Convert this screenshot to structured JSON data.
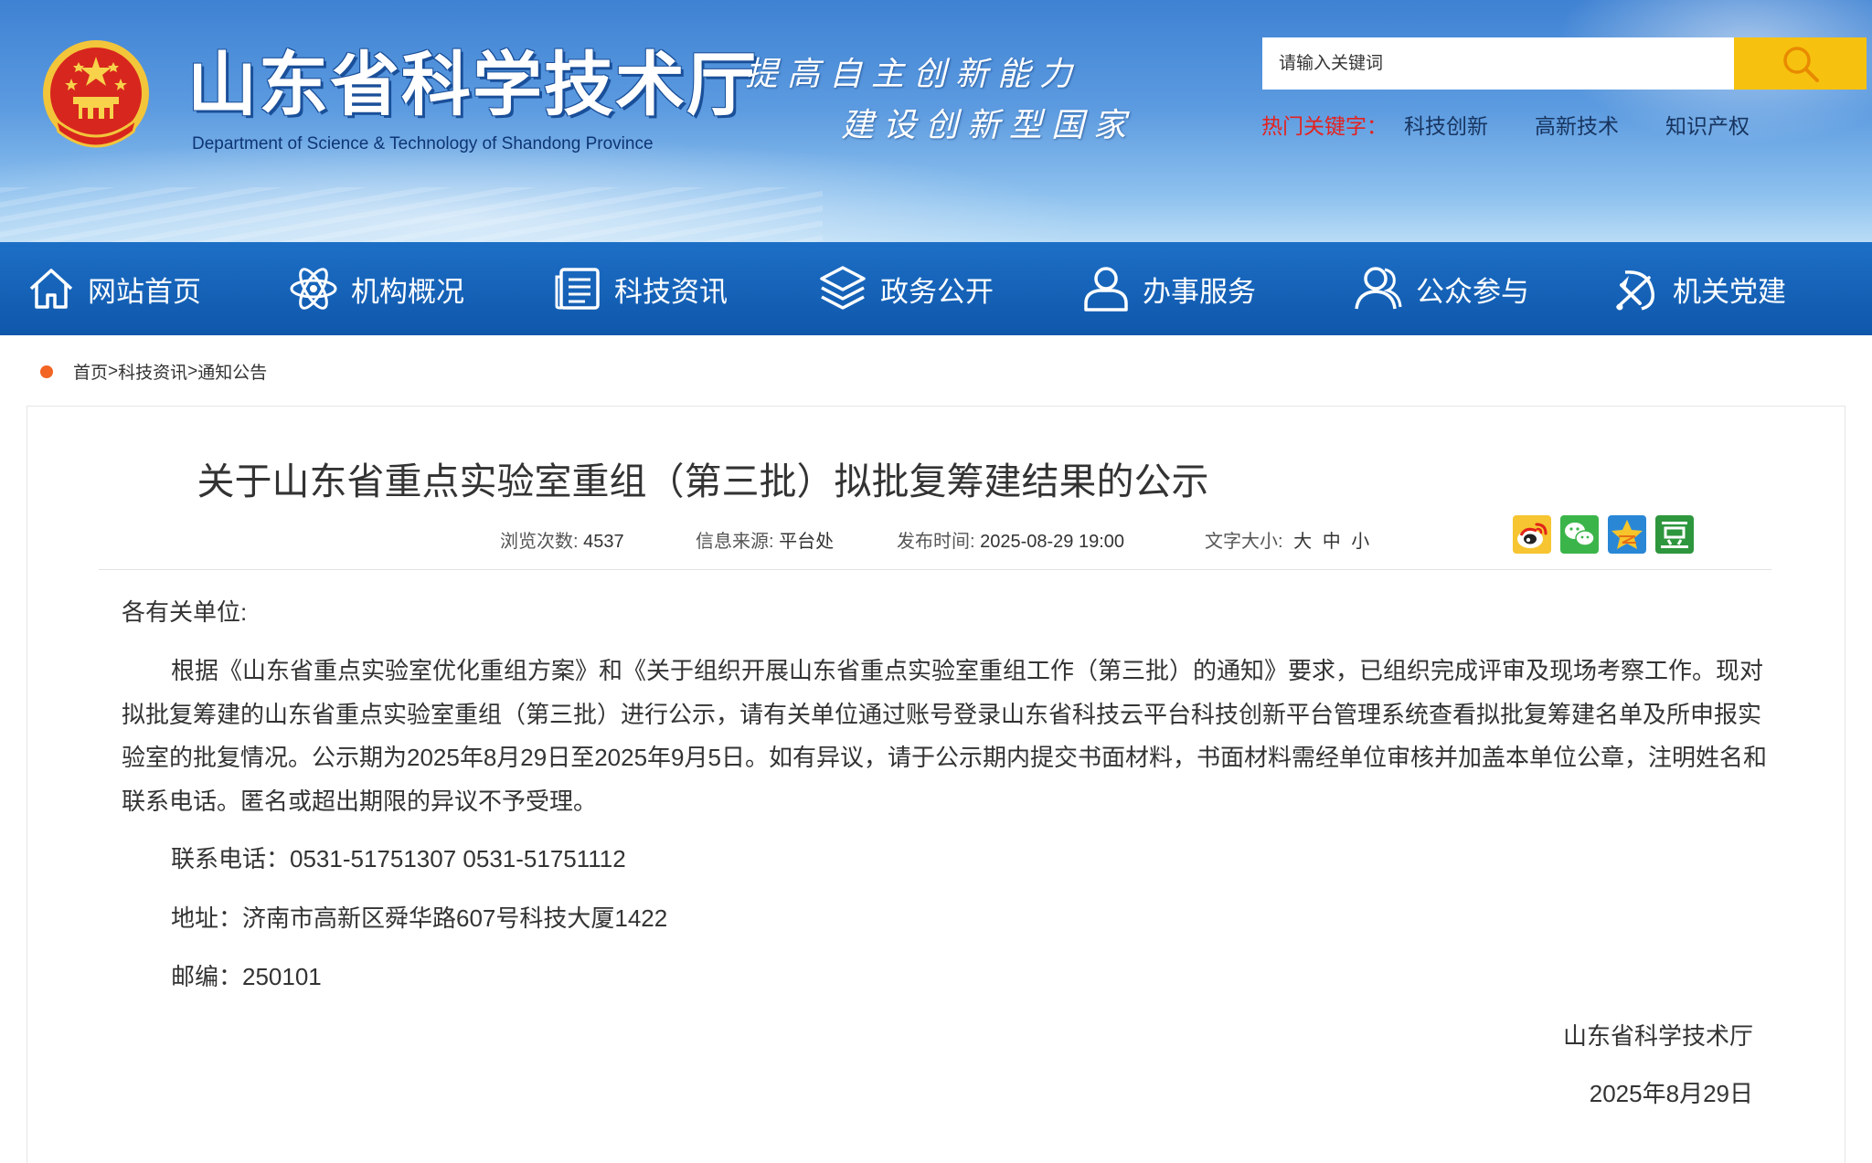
{
  "header": {
    "site_title": "山东省科学技术厅",
    "site_subtitle": "Department of Science & Technology of Shandong Province",
    "slogan_line1": "提高自主创新能力",
    "slogan_line2": "建设创新型国家",
    "search": {
      "placeholder": "请输入关键词",
      "value": ""
    },
    "hot_keywords": {
      "label": "热门关键字：",
      "items": [
        "科技创新",
        "高新技术",
        "知识产权"
      ]
    }
  },
  "nav": {
    "items": [
      {
        "label": "网站首页",
        "icon": "home-icon"
      },
      {
        "label": "机构概况",
        "icon": "atom-icon"
      },
      {
        "label": "科技资讯",
        "icon": "news-icon"
      },
      {
        "label": "政务公开",
        "icon": "layers-icon"
      },
      {
        "label": "办事服务",
        "icon": "user-icon"
      },
      {
        "label": "公众参与",
        "icon": "users-icon"
      },
      {
        "label": "机关党建",
        "icon": "party-emblem-icon"
      }
    ]
  },
  "breadcrumb": {
    "items": [
      "首页",
      "科技资讯",
      "通知公告"
    ],
    "separator": ">"
  },
  "article": {
    "title": "关于山东省重点实验室重组（第三批）拟批复筹建结果的公示",
    "meta": {
      "views_label": "浏览次数:",
      "views": "4537",
      "source_label": "信息来源:",
      "source": "平台处",
      "date_label": "发布时间:",
      "date": "2025-08-29 19:00",
      "font_size_label": "文字大小:",
      "font_sizes": [
        "大",
        "中",
        "小"
      ]
    },
    "share_icons": [
      "weibo-icon",
      "wechat-icon",
      "qzone-icon",
      "douban-icon"
    ],
    "salutation": "各有关单位:",
    "paragraph": "根据《山东省重点实验室优化重组方案》和《关于组织开展山东省重点实验室重组工作（第三批）的通知》要求，已组织完成评审及现场考察工作。现对拟批复筹建的山东省重点实验室重组（第三批）进行公示，请有关单位通过账号登录山东省科技云平台科技创新平台管理系统查看拟批复筹建名单及所申报实验室的批复情况。公示期为2025年8月29日至2025年9月5日。如有异议，请于公示期内提交书面材料，书面材料需经单位审核并加盖本单位公章，注明姓名和联系电话。匿名或超出期限的异议不予受理。",
    "contact_phone": "联系电话：0531-51751307 0531-51751112",
    "address": "地址：济南市高新区舜华路607号科技大厦1422",
    "postcode": "邮编：250101",
    "signature": "山东省科学技术厅",
    "sign_date": "2025年8月29日"
  },
  "colors": {
    "nav_bg": "#1262b8",
    "search_button": "#f6c20f",
    "hot_label": "#e4221f",
    "breadcrumb_dot": "#f26522"
  }
}
